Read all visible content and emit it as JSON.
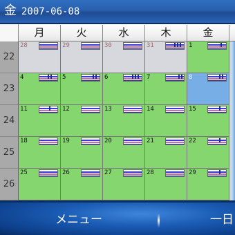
{
  "title": {
    "day": "金",
    "date": "2007-06-08"
  },
  "weekdays": [
    "月",
    "火",
    "水",
    "木",
    "金"
  ],
  "weeks": [
    {
      "number": "22",
      "days": [
        {
          "label": "28",
          "type": "other",
          "marks": []
        },
        {
          "label": "29",
          "type": "other",
          "marks": []
        },
        {
          "label": "30",
          "type": "other",
          "marks": []
        },
        {
          "label": "31",
          "type": "other",
          "marks": [
            12,
            16,
            20
          ]
        },
        {
          "label": "1",
          "type": "current",
          "marks": [
            18
          ]
        }
      ]
    },
    {
      "number": "23",
      "days": [
        {
          "label": "4",
          "type": "current",
          "marks": [
            12,
            16
          ]
        },
        {
          "label": "5",
          "type": "current",
          "marks": [
            16,
            20
          ]
        },
        {
          "label": "6",
          "type": "current",
          "marks": [
            12,
            16,
            20
          ]
        },
        {
          "label": "7",
          "type": "current",
          "marks": [
            18,
            22
          ]
        },
        {
          "label": "8",
          "type": "today",
          "marks": [
            16,
            20
          ]
        }
      ]
    },
    {
      "number": "24",
      "days": [
        {
          "label": "11",
          "type": "current",
          "marks": [
            14
          ]
        },
        {
          "label": "12",
          "type": "current",
          "marks": []
        },
        {
          "label": "13",
          "type": "current",
          "marks": []
        },
        {
          "label": "14",
          "type": "current",
          "marks": []
        },
        {
          "label": "15",
          "type": "current",
          "marks": [
            16
          ]
        }
      ]
    },
    {
      "number": "25",
      "days": [
        {
          "label": "18",
          "type": "current",
          "marks": []
        },
        {
          "label": "19",
          "type": "current",
          "marks": []
        },
        {
          "label": "20",
          "type": "current",
          "marks": []
        },
        {
          "label": "21",
          "type": "current",
          "marks": []
        },
        {
          "label": "22",
          "type": "current",
          "marks": [
            16
          ]
        }
      ]
    },
    {
      "number": "26",
      "days": [
        {
          "label": "25",
          "type": "current",
          "marks": []
        },
        {
          "label": "26",
          "type": "current",
          "marks": []
        },
        {
          "label": "27",
          "type": "current",
          "marks": []
        },
        {
          "label": "28",
          "type": "current",
          "marks": []
        },
        {
          "label": "29",
          "type": "current",
          "marks": [
            16
          ]
        }
      ]
    }
  ],
  "softkeys": {
    "left": "メニュー",
    "right": "一日"
  },
  "colors": {
    "current_day": "#86d66f",
    "other_month_day": "#d7d7de",
    "selected_day": "#78aee6",
    "week_number": "#a9a9a9"
  }
}
